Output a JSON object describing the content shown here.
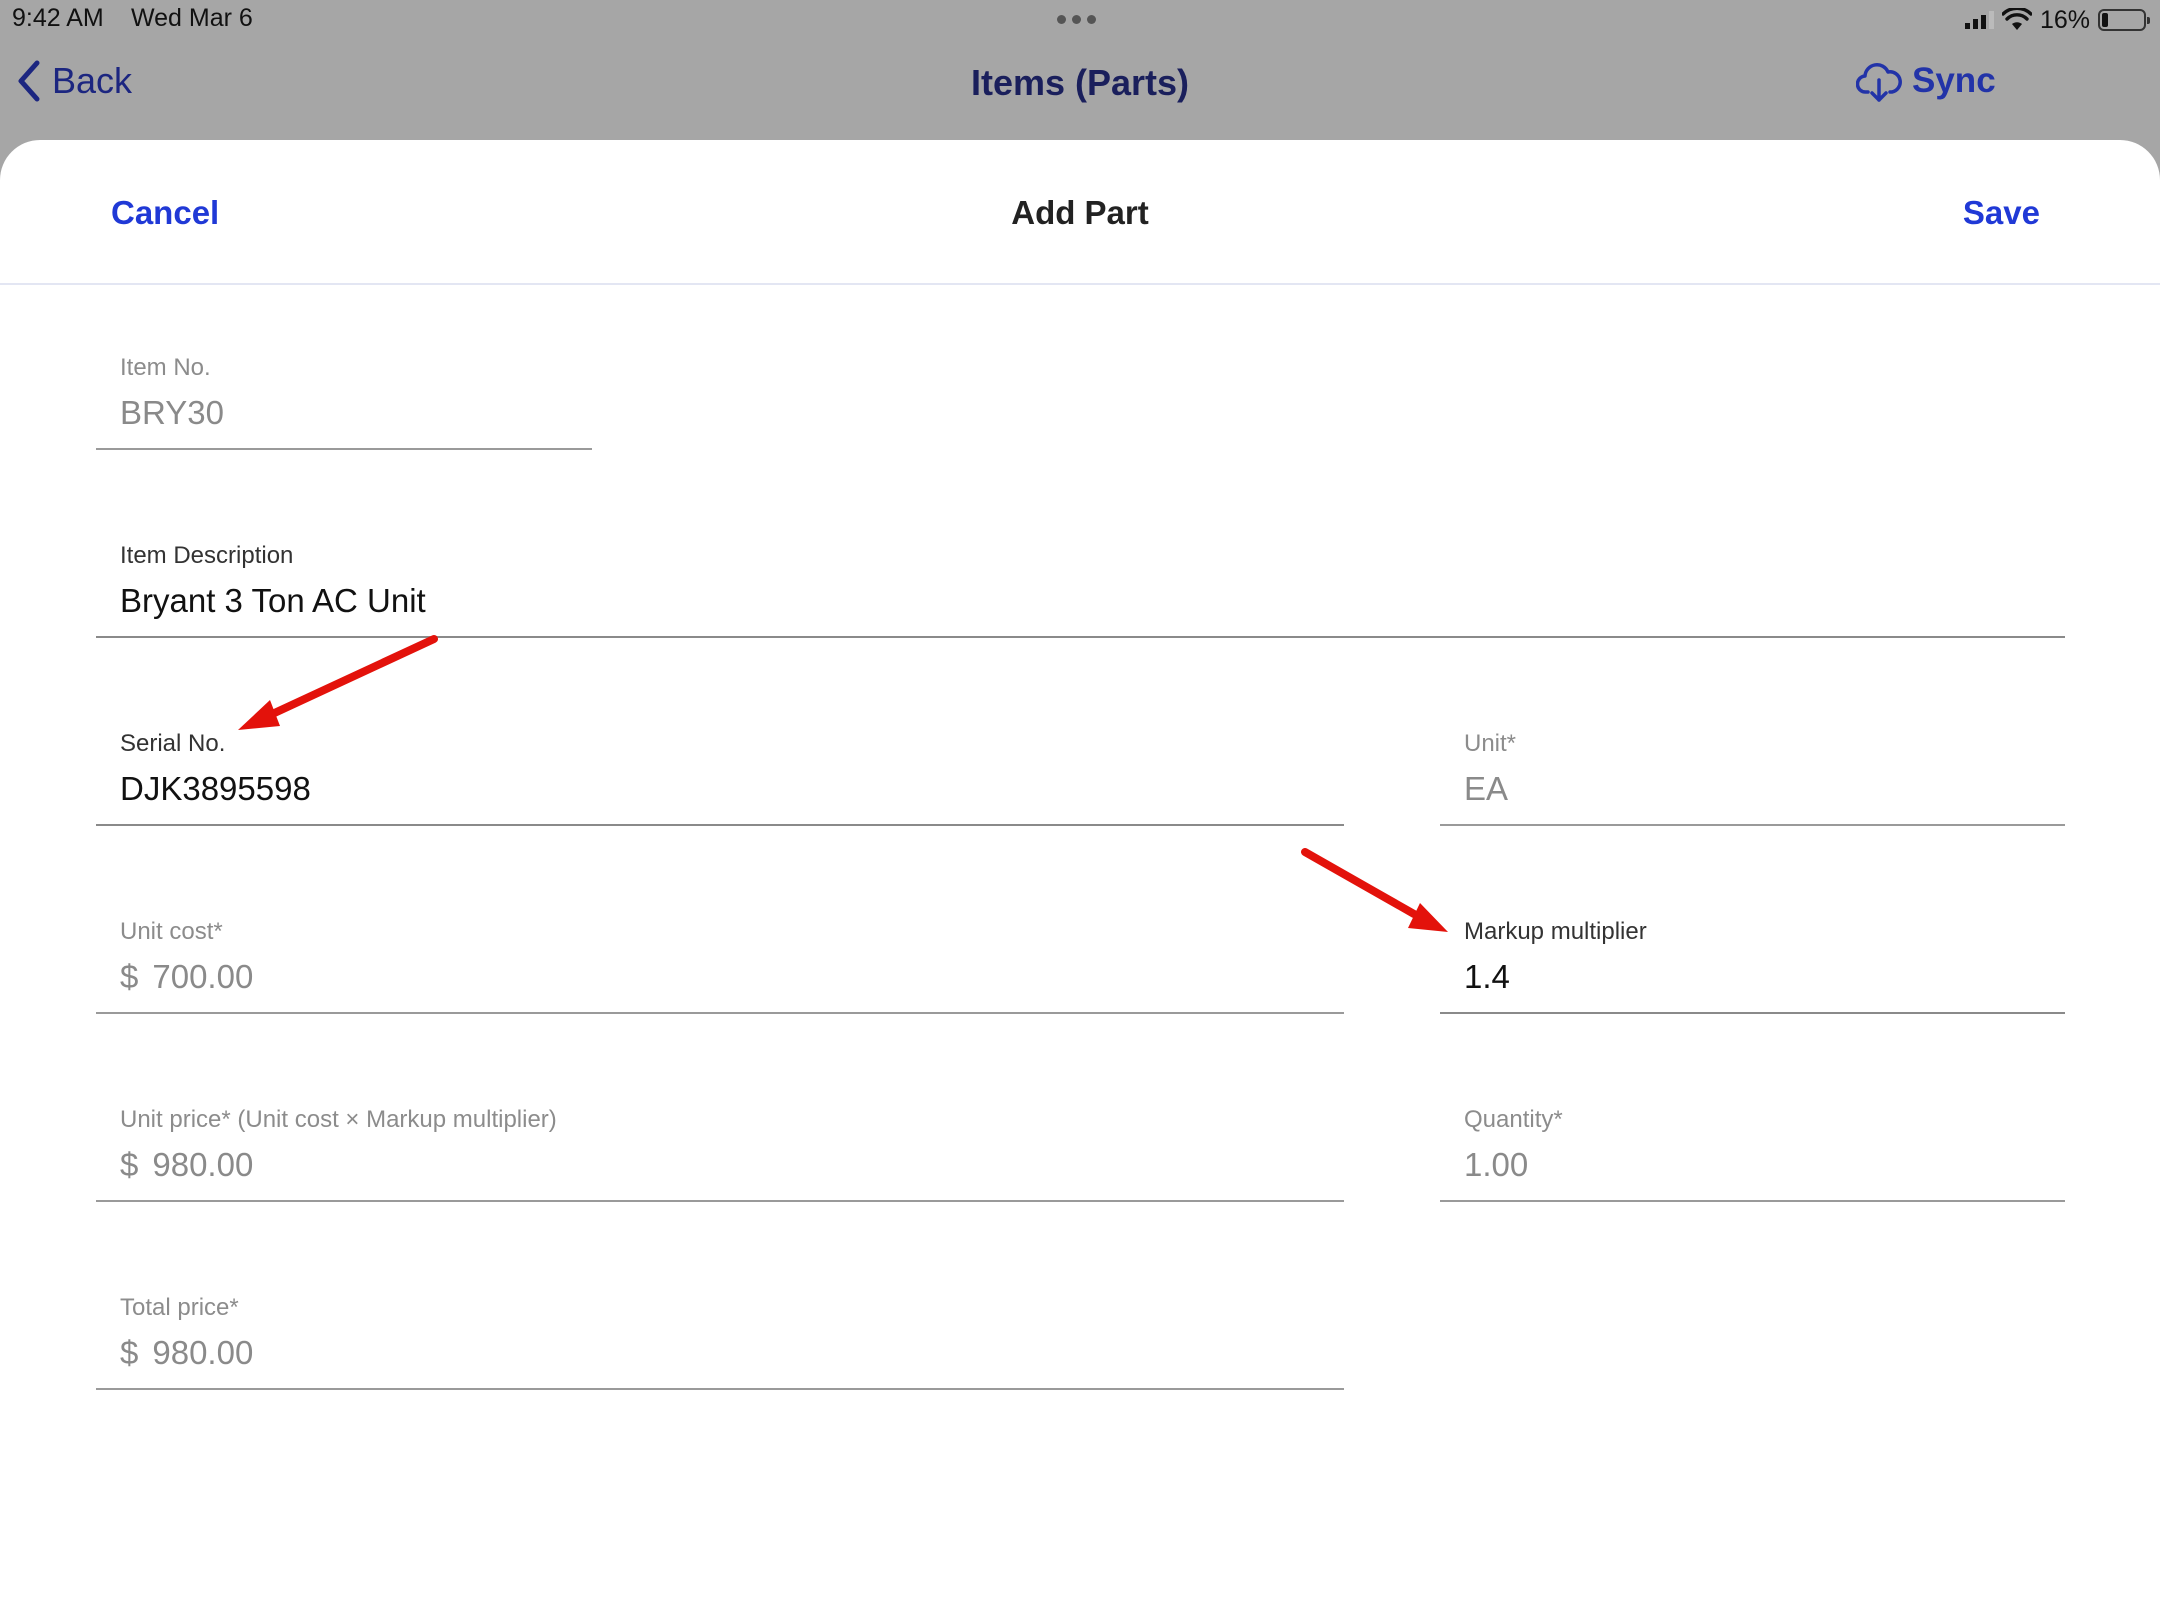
{
  "status_bar": {
    "time": "9:42 AM",
    "date": "Wed Mar 6",
    "battery_percent": "16%",
    "battery_level": 0.16,
    "signal_icon": "cellular-signal-icon",
    "wifi_icon": "wifi-icon"
  },
  "nav": {
    "back_label": "Back",
    "back_icon": "chevron-left-icon",
    "title": "Items (Parts)",
    "sync_label": "Sync",
    "sync_icon": "cloud-download-icon"
  },
  "sheet": {
    "cancel_label": "Cancel",
    "title": "Add Part",
    "save_label": "Save"
  },
  "form": {
    "item_no": {
      "label": "Item No.",
      "value": "BRY30"
    },
    "item_description": {
      "label": "Item Description",
      "value": "Bryant 3 Ton AC Unit"
    },
    "serial_no": {
      "label": "Serial No.",
      "value": "DJK3895598"
    },
    "unit": {
      "label": "Unit*",
      "value": "EA"
    },
    "unit_cost": {
      "label": "Unit cost*",
      "currency": "$",
      "value": "700.00"
    },
    "markup_multiplier": {
      "label": "Markup multiplier",
      "value": "1.4"
    },
    "unit_price": {
      "label": "Unit price* (Unit cost × Markup multiplier)",
      "currency": "$",
      "value": "980.00"
    },
    "quantity": {
      "label": "Quantity*",
      "value": "1.00"
    },
    "total_price": {
      "label": "Total price*",
      "currency": "$",
      "value": "980.00"
    }
  },
  "colors": {
    "accent": "#2039d6",
    "nav_text": "#1a1f5c",
    "annotation_arrow": "#e3120b",
    "dimmed_background": "#a6a6a6"
  }
}
